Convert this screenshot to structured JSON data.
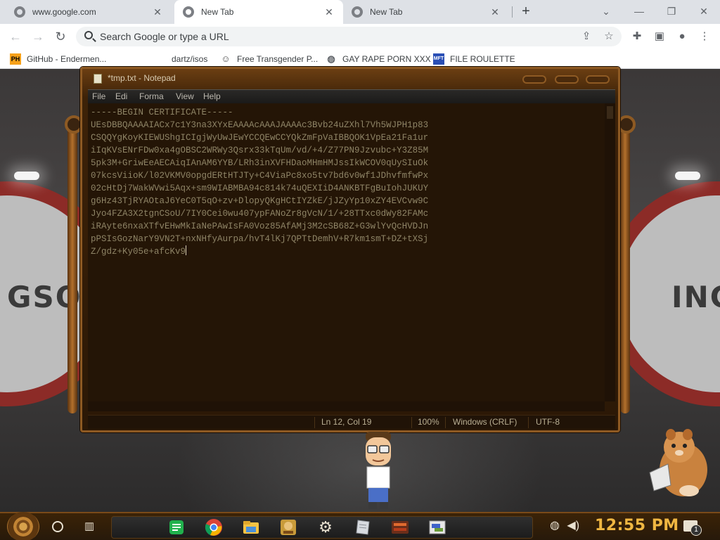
{
  "browser": {
    "tabs": [
      {
        "title": "www.google.com",
        "active": false
      },
      {
        "title": "New Tab",
        "active": true
      },
      {
        "title": "New Tab",
        "active": false
      }
    ],
    "window_controls": {
      "dropdown": "⌄",
      "minimize": "—",
      "restore": "❐",
      "close": "✕"
    },
    "omnibox": {
      "placeholder": "Search Google or type a URL",
      "value": ""
    },
    "bookmarks": [
      {
        "label": "GitHub - Endermen...",
        "icon": "PH",
        "icon_color": "#f7a11a"
      },
      {
        "label": "dartz/isos",
        "icon": "",
        "icon_color": ""
      },
      {
        "label": "Free Transgender P...",
        "icon": "mask",
        "icon_color": "#4b4b4b"
      },
      {
        "label": "GAY RAPE PORN XXX",
        "icon": "globe",
        "icon_color": "#5f6368"
      },
      {
        "label": "FILE ROULETTE",
        "icon": "MFT",
        "icon_color": "#2a4fb5"
      }
    ]
  },
  "notepad": {
    "title": "*tmp.txt - Notepad",
    "menu": [
      "File",
      "Edit",
      "Format",
      "View",
      "Help"
    ],
    "menu_visible": [
      "File",
      "Edi",
      "Forma",
      "View",
      "Help"
    ],
    "content_lines": [
      "-----BEGIN CERTIFICATE-----",
      "UEsDBBQAAAAIACx7c1Y3na3XYxEAAAAcAAAJAAAAc3Bvb24uZXhl7Vh5WJPH1p83",
      "CSQQYgKoyKIEWUShgICIgjWyUwJEwYCCQEwCCYQkZmFpVaIBBQOK1VpEa21Fa1ur",
      "iIqKVsENrFDw0xa4gOBSC2WRWy3Qsrx33kTqUm/vd/+4/Z77PN9Jzvubc+Y3Z85M",
      "5pk3M+GriwEeAECAiqIAnAM6YYB/LRh3inXVFHDaoMHmHMJssIkWCOV0qUySIuOk",
      "07kcsViioK/l02VKMV0opgdERtHTJTy+C4ViaPc8xo5tv7bd6v0wf1JDhvfmfwPx",
      "02cHtDj7WakWVwi5Aqx+sm9WIABMBA94c814k74uQEXIiD4ANKBTFgBuIohJUKUY",
      "g6Hz43TjRYAOtaJ6YeC0T5qO+zv+DlopyQKgHCtIYZkE/jJZyYp10xZY4EVCvw9C",
      "Jyo4FZA3X2tgnCSoU/7IY0Cei0wu407ypFANoZr8gVcN/1/+28TTxc0dWy82FAMc",
      "iRAyte6nxaXTfvEHwMkIaNePAwIsFA0Voz85AfAMj3M2cSB68Z+G3wlYvQcHVDJn",
      "pPSIsGozNarY9VN2T+nxNHfyAurpa/hvT4lKj7QPTtDemhV+R7km1smT+DZ+tXSj",
      "Z/gdz+Ky05e+afcKv9"
    ],
    "status": {
      "position": "Ln 12, Col 19",
      "zoom": "100%",
      "line_ending": "Windows (CRLF)",
      "encoding": "UTF-8"
    }
  },
  "desktop": {
    "wallpaper_text_left": "GSOO",
    "wallpaper_text_right": "INC",
    "mascot_left": "cartoon-man-icon",
    "mascot_right": "hamster-reading-icon"
  },
  "taskbar": {
    "apps": [
      "notes-icon",
      "chrome-icon",
      "file-explorer-icon",
      "game-icon",
      "settings-icon",
      "notepad-icon",
      "media-icon",
      "screenshot-icon"
    ],
    "clock": "12:55 PM",
    "notification_count": "1"
  },
  "colors": {
    "notepad_text": "#8e8466",
    "clock": "#f0b742",
    "frame_brass": "#8e5a23"
  }
}
